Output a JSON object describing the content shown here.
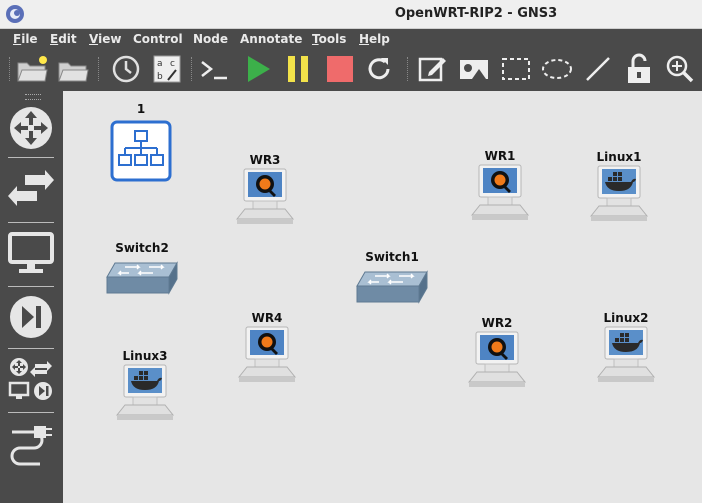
{
  "window": {
    "title": "OpenWRT-RIP2 - GNS3"
  },
  "menu": [
    {
      "label": "File",
      "u": "F",
      "rest": "ile"
    },
    {
      "label": "Edit",
      "u": "E",
      "rest": "dit"
    },
    {
      "label": "View",
      "u": "V",
      "rest": "iew"
    },
    {
      "label": "Control",
      "u": "",
      "rest": "Control"
    },
    {
      "label": "Node",
      "u": "",
      "rest": "Node"
    },
    {
      "label": "Annotate",
      "u": "",
      "rest": "Annotate"
    },
    {
      "label": "Tools",
      "u": "T",
      "rest": "ools"
    },
    {
      "label": "Help",
      "u": "H",
      "rest": "elp"
    }
  ],
  "nodes": {
    "group1": "1",
    "wr3": "WR3",
    "wr1": "WR1",
    "linux1": "Linux1",
    "switch2": "Switch2",
    "switch1": "Switch1",
    "wr4": "WR4",
    "wr2": "WR2",
    "linux2": "Linux2",
    "linux3": "Linux3"
  },
  "colors": {
    "toolbar_bg": "#4a4a4a",
    "canvas_bg": "#e6e6e6",
    "start_green": "#3cb04a",
    "pause_yellow": "#f2e24a",
    "stop_red": "#ef6b6b",
    "group_blue": "#2d6fd0"
  }
}
